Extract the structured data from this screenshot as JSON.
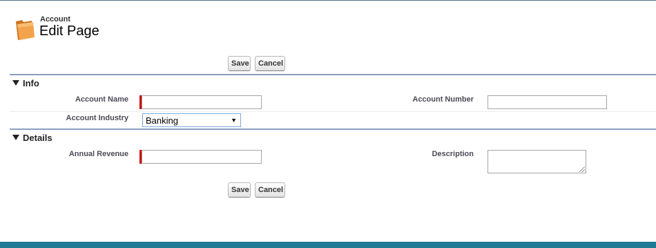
{
  "header": {
    "object_label": "Account",
    "title": "Edit Page",
    "icon": "folder-icon"
  },
  "buttons": {
    "save": "Save",
    "cancel": "Cancel"
  },
  "sections": {
    "info": {
      "title": "Info",
      "fields": {
        "account_name": {
          "label": "Account Name",
          "value": "",
          "required": true
        },
        "account_number": {
          "label": "Account Number",
          "value": ""
        },
        "account_industry": {
          "label": "Account Industry",
          "value": "Banking"
        }
      }
    },
    "details": {
      "title": "Details",
      "fields": {
        "annual_revenue": {
          "label": "Annual Revenue",
          "value": "",
          "required": true
        },
        "description": {
          "label": "Description",
          "value": ""
        }
      }
    }
  },
  "colors": {
    "required_marker": "#cc0000",
    "section_rule": "#8a9ebe",
    "footer_bar": "#1f7a96"
  }
}
